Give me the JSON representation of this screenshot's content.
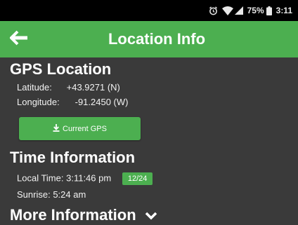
{
  "status_bar": {
    "battery": "75%",
    "time": "3:11"
  },
  "app_bar": {
    "title": "Location Info",
    "back_icon": "arrow-left-icon"
  },
  "gps": {
    "title": "GPS Location",
    "latitude_label": "Latitude:",
    "latitude_value": "+43.9271 (N)",
    "longitude_label": "Longitude:",
    "longitude_value": "-91.2450 (W)",
    "button_label": "Current GPS",
    "button_icon": "download-icon"
  },
  "time": {
    "title": "Time Information",
    "local_time_label": "Local Time:",
    "local_time_value": "3:11:46 pm",
    "format_toggle": "12/24",
    "sunrise_label": "Sunrise:",
    "sunrise_value": "5:24 am"
  },
  "more": {
    "title": "More Information",
    "icon": "chevron-down-icon"
  },
  "colors": {
    "accent": "#4caf50",
    "background": "#3a3a3a",
    "status_bar": "#000000"
  }
}
